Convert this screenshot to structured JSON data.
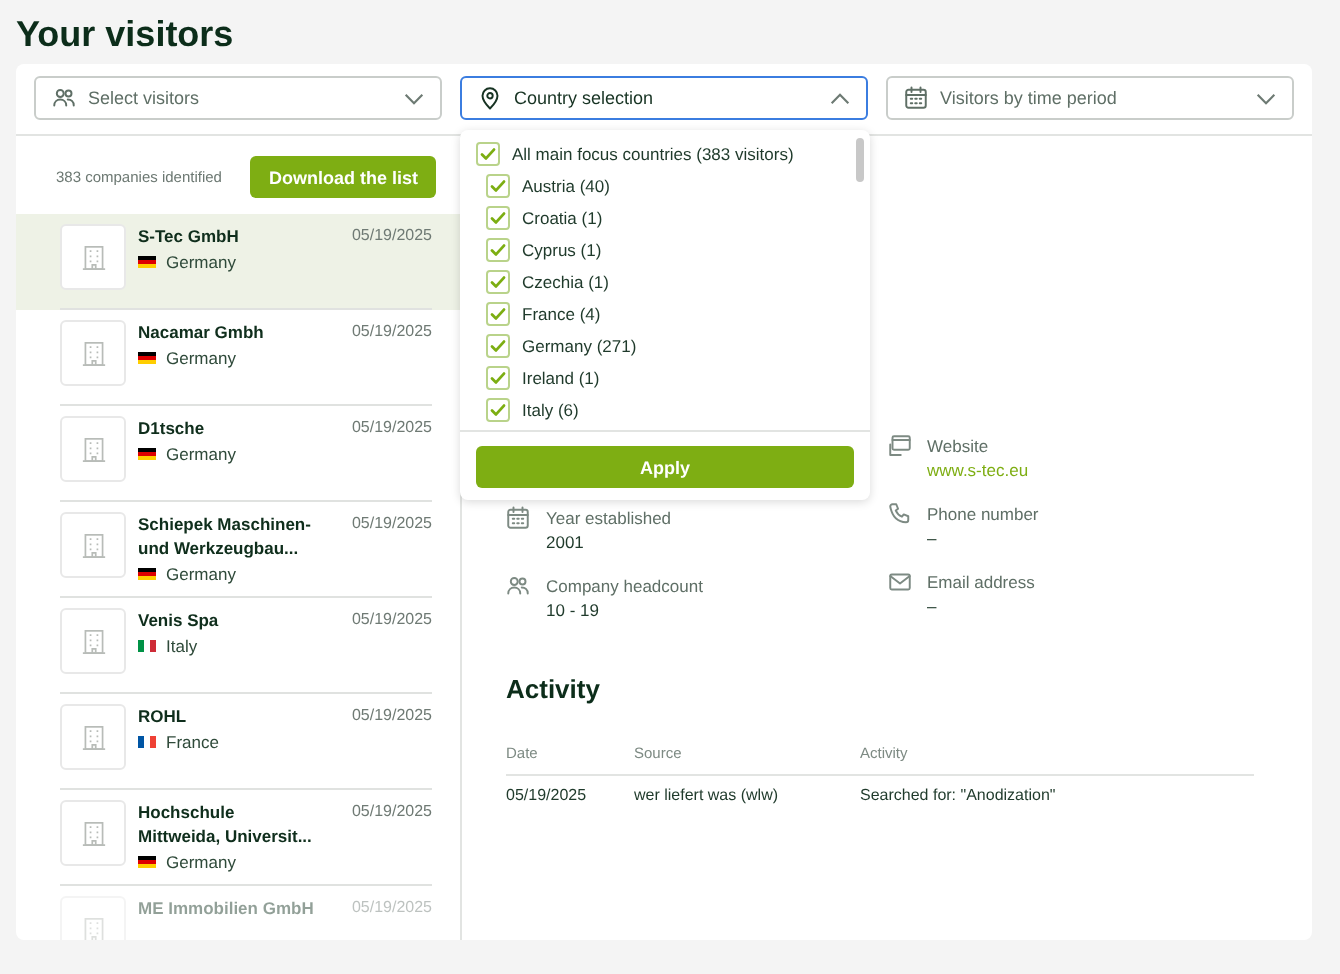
{
  "page_title": "Your visitors",
  "filters": [
    {
      "kind": "people",
      "label": "Select visitors",
      "expanded": false
    },
    {
      "kind": "location",
      "label": "Country selection",
      "expanded": true
    },
    {
      "kind": "calendar",
      "label": "Visitors by time period",
      "expanded": false
    }
  ],
  "list_header": {
    "count": "383 companies identified",
    "download_button": "Download the list"
  },
  "companies": [
    {
      "name": "S-Tec GmbH",
      "date": "05/19/2025",
      "country": "Germany",
      "kind": "de",
      "selected": true,
      "faded": false
    },
    {
      "name": "Nacamar Gmbh",
      "date": "05/19/2025",
      "country": "Germany",
      "kind": "de",
      "selected": false,
      "faded": false
    },
    {
      "name": "D1tsche",
      "date": "05/19/2025",
      "country": "Germany",
      "kind": "de",
      "selected": false,
      "faded": false
    },
    {
      "name": "Schiepek Maschinen- und Werkzeugbau...",
      "date": "05/19/2025",
      "country": "Germany",
      "kind": "de",
      "selected": false,
      "faded": false
    },
    {
      "name": "Venis Spa",
      "date": "05/19/2025",
      "country": "Italy",
      "kind": "it",
      "selected": false,
      "faded": false
    },
    {
      "name": "ROHL",
      "date": "05/19/2025",
      "country": "France",
      "kind": "fr",
      "selected": false,
      "faded": false
    },
    {
      "name": "Hochschule Mittweida, Universit...",
      "date": "05/19/2025",
      "country": "Germany",
      "kind": "de",
      "selected": false,
      "faded": false
    },
    {
      "name": "ME Immobilien GmbH",
      "date": "05/19/2025",
      "selected": false,
      "faded": true
    }
  ],
  "country_dropdown": {
    "all": {
      "label": "All main focus countries (383 visitors)",
      "checked": true
    },
    "countries": [
      {
        "label": "Austria (40)",
        "checked": true
      },
      {
        "label": "Croatia (1)",
        "checked": true
      },
      {
        "label": "Cyprus (1)",
        "checked": true
      },
      {
        "label": "Czechia (1)",
        "checked": true
      },
      {
        "label": "France (4)",
        "checked": true
      },
      {
        "label": "Germany (271)",
        "checked": true
      },
      {
        "label": "Ireland (1)",
        "checked": true
      },
      {
        "label": "Italy (6)",
        "checked": true
      }
    ],
    "apply_button": "Apply"
  },
  "details_left": [
    {
      "kind": "calendar",
      "label": "Year established",
      "value": "2001"
    },
    {
      "kind": "people",
      "label": "Company headcount",
      "value": "10 - 19"
    }
  ],
  "details_right": [
    {
      "kind": "website",
      "label": "Website",
      "value": "www.s-tec.eu",
      "link": true
    },
    {
      "kind": "phone",
      "label": "Phone number",
      "value": "–",
      "link": false
    },
    {
      "kind": "email",
      "label": "Email address",
      "value": "–",
      "link": false
    }
  ],
  "activity": {
    "title": "Activity",
    "columns": [
      "Date",
      "Source",
      "Activity"
    ],
    "rows": [
      [
        "05/19/2025",
        "wer liefert was (wlw)",
        "Searched for: \"Anodization\""
      ]
    ]
  }
}
